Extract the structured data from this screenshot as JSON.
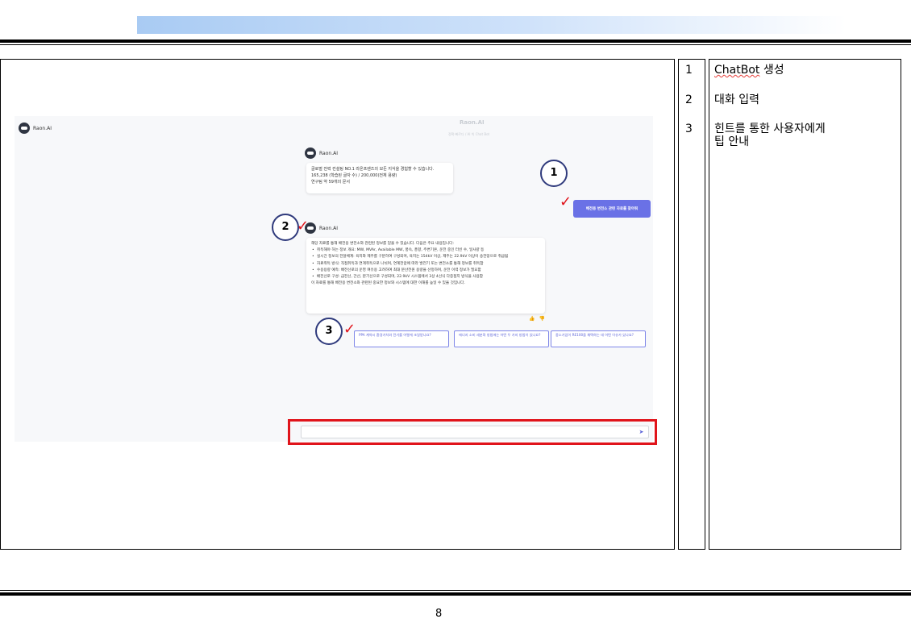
{
  "page": {
    "number": "8"
  },
  "legend": {
    "numbers": [
      "1",
      "2",
      "3"
    ],
    "descriptions": [
      {
        "prefix": "ChatBot",
        "suffix": " 생성"
      },
      {
        "text": "대화 입력"
      },
      {
        "line1": "힌트를 통한 사용자에게",
        "line2": "팁 안내"
      }
    ]
  },
  "app": {
    "logo_text": "Raon.AI",
    "title": "Raon.AI",
    "subtitle": "정확·빠르다 / AI 빅 Chat Bot",
    "welcome": {
      "sender": "Raon.AI",
      "lines": [
        "글로벌 전력 컨설팅 NO.1 라온프렌즈의 모든 지식을 경험할 수 있습니다.",
        "165,238 (학습된 글자 수) / 200,000(전체 용량)",
        "연구팀 약 59개의 문서"
      ]
    },
    "user_message": "배전용 변전소 관련 자료를 찾아줘",
    "response": {
      "sender": "Raon.AI",
      "intro": "해당 자료를 통해 배전용 변전소와 관련된 정보를 얻을 수 있습니다. 다음은 주요 내용입니다:",
      "bullets": [
        "취득해야 하는 정보 개요: MW, MVAr, Available MW, 풍속, 풍향, 주변기온, 운전 중인 터빈 수, 일사량 등",
        "실시간 정보의 전달체계: 육지와 제주를 구분하여 구성되며, 육지는 154kV 이상, 제주는 22.9kV 이상이 송전망으로 취급됨",
        "자료취득 방식: 직접취득과 연계취득으로 나뉘며, 연계전압에 따라 발전기 또는 변전소를 통해 정보를 취득함",
        "수용용량 예측: 배전선로의 운영 여유용 고려하여 최대 분산전원 용량을 산정하며, 운전 이력 정보가 필요함",
        "배전선로 구성: 급전선, 간선, 분기선으로 구성되며, 22.9kV 시스템에서 3상 4선식 다중접지 방식을 사용함"
      ],
      "outro": "이 자료를 통해 배전용 변전소와 관련된 중요한 정보와 시스템에 대한 이해를 높일 수 있을 것입니다."
    },
    "hints": [
      "PPA 계약시 환경가치와 전기를 어떻게 조달받나요?",
      "에너지 소비 세분화 방법에는 어떤 두 가지 방법이 있나요?",
      "중소기업이 RE100을 채택하는 데 어떤 이슈가 있나요?"
    ],
    "input": {
      "value": "",
      "placeholder": ""
    }
  },
  "callouts": [
    "1",
    "2",
    "3"
  ],
  "icons": {
    "check": "✓",
    "thumb_up": "👍",
    "thumb_down": "👎",
    "send": "➤",
    "attach": "✎"
  },
  "colors": {
    "accent": "#6a71e6",
    "highlight": "#e0141b",
    "header_gradient": "#a9cbf3"
  }
}
